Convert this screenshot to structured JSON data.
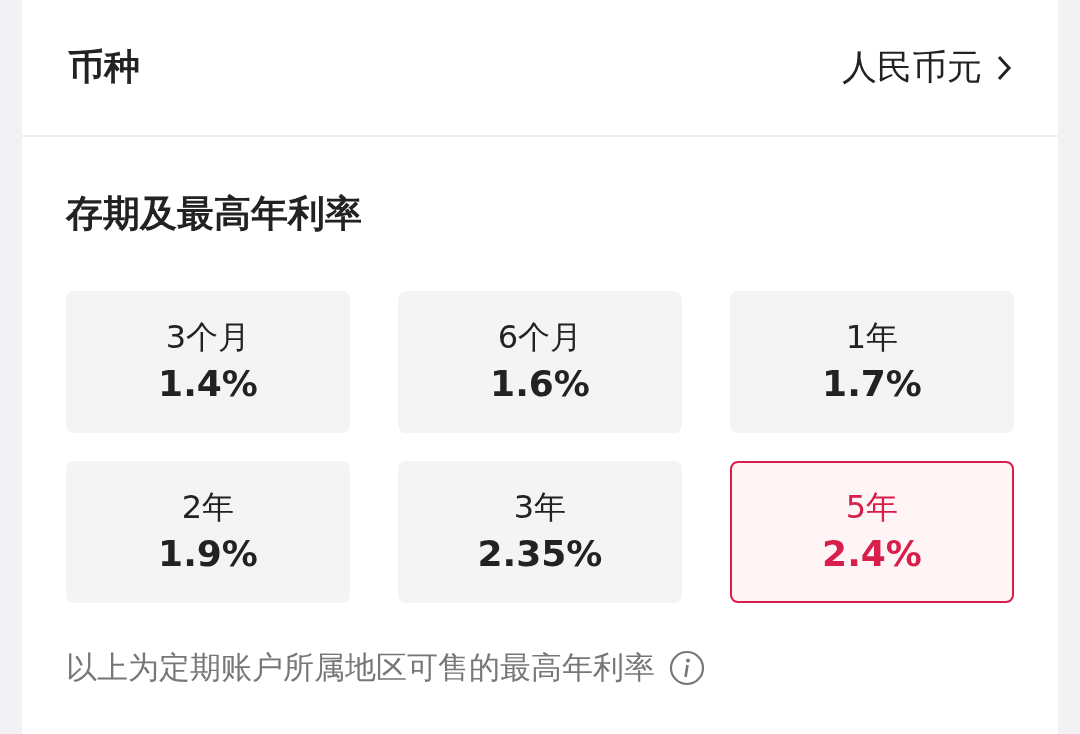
{
  "currency": {
    "label": "币种",
    "value": "人民币元"
  },
  "term_section": {
    "title": "存期及最高年利率",
    "terms": [
      {
        "term": "3个月",
        "rate": "1.4%",
        "selected": false
      },
      {
        "term": "6个月",
        "rate": "1.6%",
        "selected": false
      },
      {
        "term": "1年",
        "rate": "1.7%",
        "selected": false
      },
      {
        "term": "2年",
        "rate": "1.9%",
        "selected": false
      },
      {
        "term": "3年",
        "rate": "2.35%",
        "selected": false
      },
      {
        "term": "5年",
        "rate": "2.4%",
        "selected": true
      }
    ],
    "note": "以上为定期账户所属地区可售的最高年利率"
  }
}
